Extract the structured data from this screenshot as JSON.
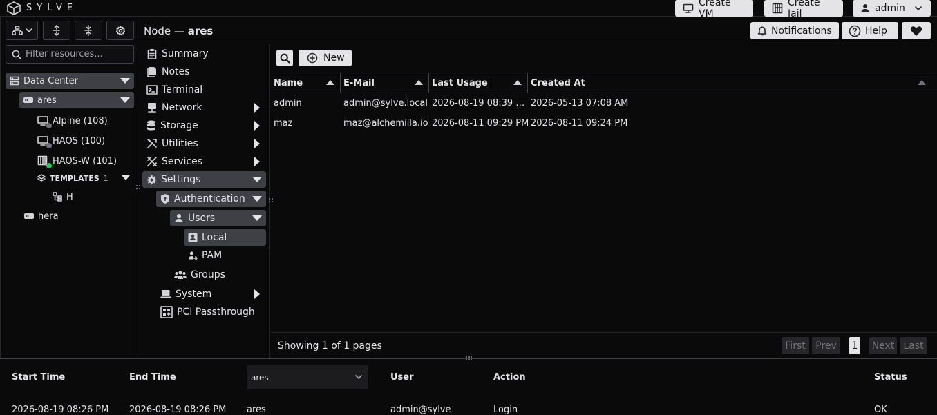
{
  "app": {
    "name": "SYLVE"
  },
  "topbar": {
    "create_vm": "Create VM",
    "create_jail": "Create Jail",
    "user": "admin"
  },
  "tree": {
    "filter_placeholder": "Filter resources...",
    "datacenter": "Data Center",
    "nodes": [
      {
        "name": "ares"
      },
      {
        "name": "hera"
      }
    ],
    "guests": [
      {
        "label": "Alpine (108)",
        "status_color": "#71717a"
      },
      {
        "label": "HAOS (100)",
        "status_color": "#71717a"
      },
      {
        "label": "HAOS-W (101)",
        "status_color": "#22c55e"
      }
    ],
    "templates": {
      "label": "TEMPLATES",
      "count": "1",
      "items": [
        "H"
      ]
    }
  },
  "header": {
    "prefix": "Node —",
    "node": "ares",
    "notifications": "Notifications",
    "help": "Help"
  },
  "menu": {
    "summary": "Summary",
    "notes": "Notes",
    "terminal": "Terminal",
    "network": "Network",
    "storage": "Storage",
    "utilities": "Utilities",
    "services": "Services",
    "settings": "Settings",
    "authentication": "Authentication",
    "users": "Users",
    "local": "Local",
    "pam": "PAM",
    "groups": "Groups",
    "system": "System",
    "pci": "PCI Passthrough"
  },
  "toolbar": {
    "new_label": "New"
  },
  "users_table": {
    "columns": [
      "Name",
      "E-Mail",
      "Last Usage",
      "Created At"
    ],
    "rows": [
      [
        "admin",
        "admin@sylve.local",
        "2026-08-19 08:39 …",
        "2026-05-13 07:08 AM"
      ],
      [
        "maz",
        "maz@alchemilla.io",
        "2026-08-11 09:29 PM",
        "2026-08-11 09:24 PM"
      ]
    ]
  },
  "pagination": {
    "summary": "Showing 1 of 1 pages",
    "first": "First",
    "prev": "Prev",
    "page": "1",
    "next": "Next",
    "last": "Last"
  },
  "log": {
    "columns": {
      "start": "Start Time",
      "end": "End Time",
      "user": "User",
      "action": "Action",
      "status": "Status"
    },
    "node_filter": "ares",
    "row": {
      "start": "2026-08-19 08:26 PM",
      "end": "2026-08-19 08:26 PM",
      "node": "ares",
      "user": "admin@sylve",
      "action": "Login",
      "status": "OK"
    }
  },
  "colors": {
    "bg": "#0a0a0a",
    "selected": "#3f3f46",
    "button": "#e4e4e7",
    "online": "#22c55e"
  }
}
